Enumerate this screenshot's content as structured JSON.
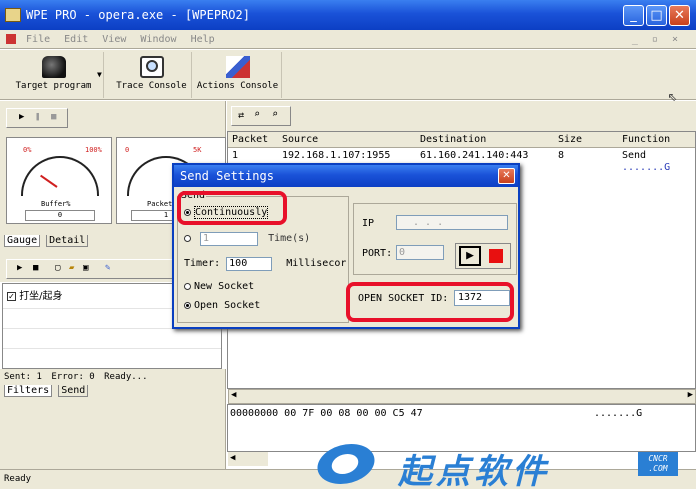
{
  "window": {
    "title": "WPE PRO - opera.exe - [WPEPRO2]"
  },
  "menu": [
    "File",
    "Edit",
    "View",
    "Window",
    "Help"
  ],
  "toolbar": {
    "target_label": "Target program",
    "trace_label": "Trace Console",
    "actions_label": "Actions Console"
  },
  "gauges": {
    "g1_min": "0%",
    "g1_max": "100%",
    "g1_name": "Buffer%",
    "g1_value": "0",
    "g2_min": "0",
    "g2_max": "5K",
    "g2_name": "Packet",
    "g2_value": "1"
  },
  "tabs_top": [
    "Gauge",
    "Detail"
  ],
  "filters_list": [
    "打坐/起身"
  ],
  "status_line": {
    "sent": "Sent: 1",
    "error": "Error: 0",
    "state": "Ready..."
  },
  "tabs_bottom": [
    "Filters",
    "Send"
  ],
  "packets": {
    "columns": [
      "Packet",
      "Source",
      "Destination",
      "Size",
      "Function"
    ],
    "rows": [
      {
        "packet": "1",
        "source": "192.168.1.107:1955",
        "destination": "61.160.241.140:443",
        "size": "8",
        "function": "Send"
      }
    ],
    "ascii": ".......G"
  },
  "hex": {
    "line": "00000000 00 7F 00 08 00 00 C5 47",
    "ascii": ".......G"
  },
  "statusbar": "Ready",
  "dialog": {
    "title": "Send Settings",
    "send_group": "Send",
    "continuously": "Continuously",
    "times_value": "1",
    "times_label": "Time(s)",
    "timer_label": "Timer:",
    "timer_value": "100",
    "timer_unit": "Millisecor",
    "new_socket": "New Socket",
    "open_socket": "Open Socket",
    "ip_label": "IP",
    "ip_value": ". . .",
    "port_label": "PORT:",
    "port_value": "0",
    "open_socket_id_label": "OPEN SOCKET ID:",
    "open_socket_id_value": "1372"
  },
  "watermark": {
    "text": "起点软件",
    "badge_top": "CNCR",
    "badge_bottom": ".COM"
  },
  "colors": {
    "title_blue": "#1a52d8",
    "highlight_red": "#e8102a",
    "chrome": "#ece9d8"
  }
}
